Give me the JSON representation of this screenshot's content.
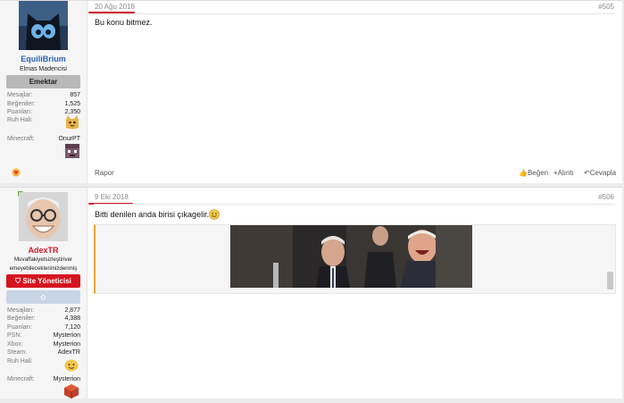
{
  "posts": [
    {
      "user": {
        "name": "EquiliBrium",
        "title": "Elmas Madencisi",
        "banner": "Emektar"
      },
      "stats": [
        {
          "k": "Mesajlar:",
          "v": "857"
        },
        {
          "k": "Beğeniler:",
          "v": "1,525"
        },
        {
          "k": "Puanları:",
          "v": "2,350"
        },
        {
          "k": "Ruh Hali:",
          "v": ""
        },
        {
          "k": "Minecraft:",
          "v": "OnurPT"
        }
      ],
      "date": "20 Ağu 2018",
      "number": "#505",
      "text": "Bu konu bitmez.",
      "actions": {
        "report": "Rapor",
        "like": "Beğen",
        "quote": "+Alıntı",
        "reply": "Cevapla"
      }
    },
    {
      "user": {
        "name": "AdexTR",
        "title": "Muvaffakiyetsizleştiriveremeyebileceklerimizdenmiş",
        "banner": "Site Yöneticisi"
      },
      "stats": [
        {
          "k": "Mesajları:",
          "v": "2,877"
        },
        {
          "k": "Beğeniler:",
          "v": "4,388"
        },
        {
          "k": "Puanları:",
          "v": "7,120"
        },
        {
          "k": "PSN:",
          "v": "Mysterion"
        },
        {
          "k": "Xbox:",
          "v": "Mysterion"
        },
        {
          "k": "Steam:",
          "v": "AdexTR"
        },
        {
          "k": "Ruh Hali:",
          "v": ""
        },
        {
          "k": "Minecraft:",
          "v": "Mysterion"
        }
      ],
      "date": "9 Eki 2018",
      "number": "#506",
      "text": "Bitti denilen anda birisi çıkagelir."
    }
  ],
  "colors": {
    "accent_red": "#d0192b",
    "link_gray": "#8a8a8a",
    "gif_border": "#f0a23b"
  },
  "icons": [
    "heart-emoji-icon",
    "mood-cat-icon",
    "minecraft-head-icon",
    "shield-icon",
    "diamond-icon",
    "smile-emoji-icon",
    "thumb-up-icon",
    "reply-icon"
  ]
}
